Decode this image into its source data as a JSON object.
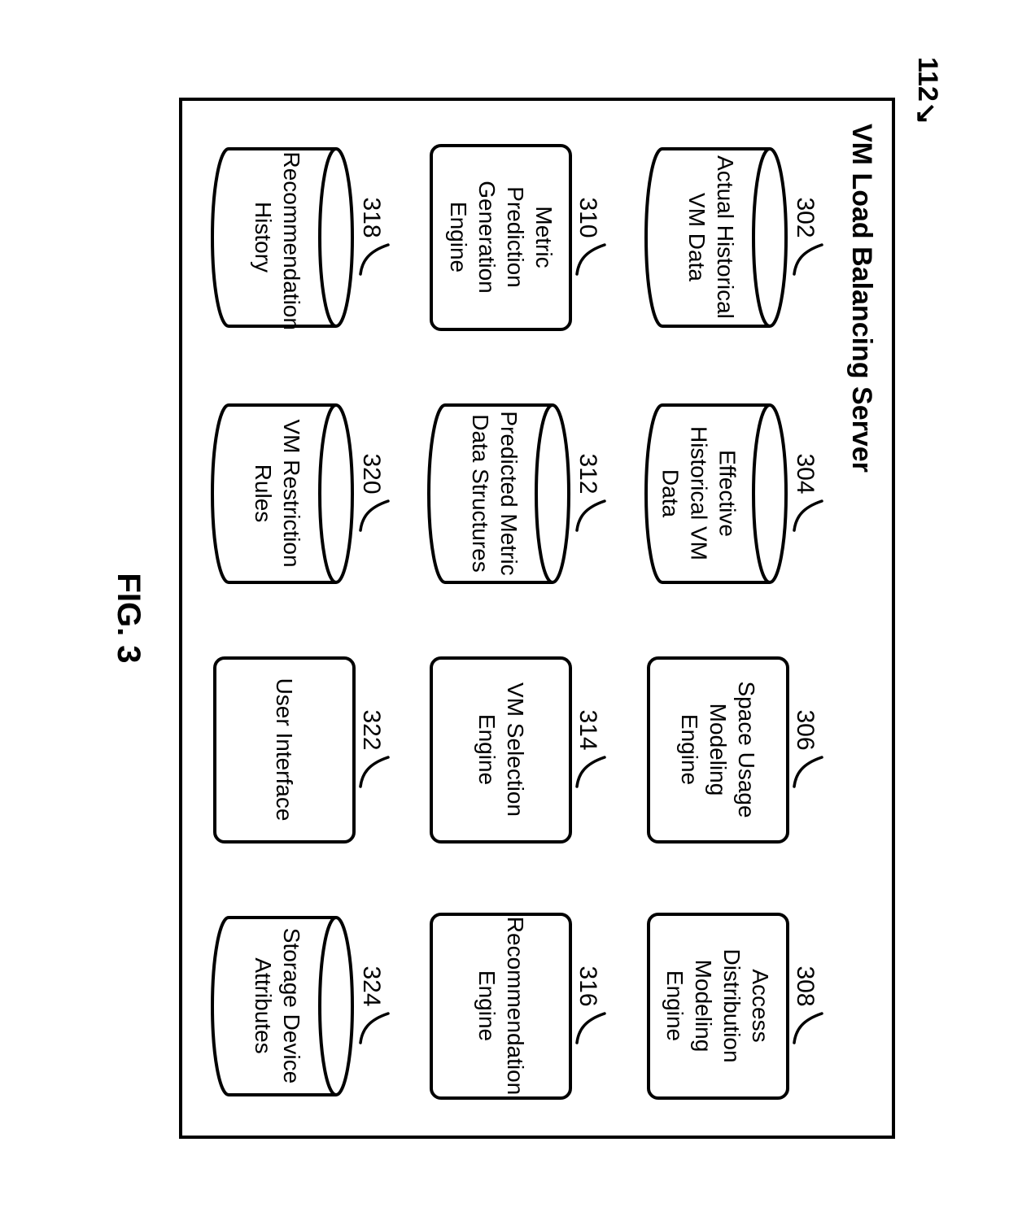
{
  "outer_ref": "112",
  "server_title": "VM Load Balancing Server",
  "figure_caption": "FIG. 3",
  "components": {
    "c302": {
      "ref": "302",
      "label": "Actual Historical VM Data",
      "shape": "cyl"
    },
    "c304": {
      "ref": "304",
      "label": "Effective Historical VM Data",
      "shape": "cyl"
    },
    "c306": {
      "ref": "306",
      "label": "Space Usage Modeling Engine",
      "shape": "rect"
    },
    "c308": {
      "ref": "308",
      "label": "Access Distribution Modeling Engine",
      "shape": "rect"
    },
    "c310": {
      "ref": "310",
      "label": "Metric Prediction Generation Engine",
      "shape": "rect"
    },
    "c312": {
      "ref": "312",
      "label": "Predicted Metric Data Structures",
      "shape": "cyl"
    },
    "c314": {
      "ref": "314",
      "label": "VM Selection Engine",
      "shape": "rect"
    },
    "c316": {
      "ref": "316",
      "label": "Recommendation Engine",
      "shape": "rect"
    },
    "c318": {
      "ref": "318",
      "label": "Recommendation History",
      "shape": "cyl"
    },
    "c320": {
      "ref": "320",
      "label": "VM Restriction Rules",
      "shape": "cyl"
    },
    "c322": {
      "ref": "322",
      "label": "User Interface",
      "shape": "rect"
    },
    "c324": {
      "ref": "324",
      "label": "Storage Device Attributes",
      "shape": "cyl"
    }
  }
}
